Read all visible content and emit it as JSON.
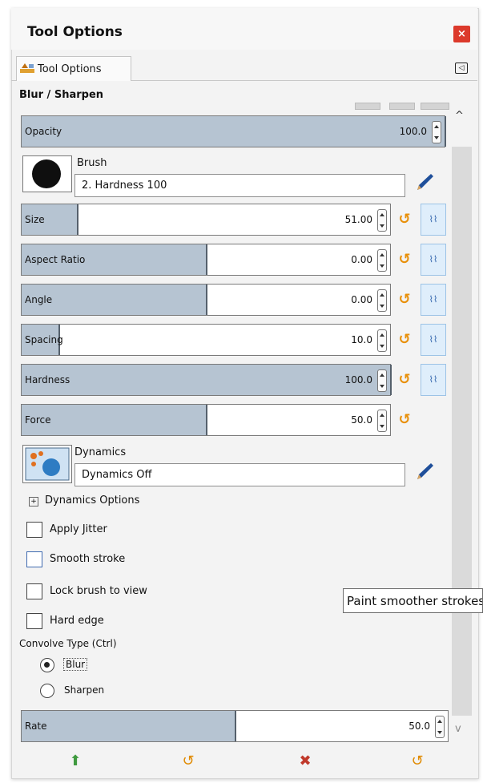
{
  "window": {
    "title": "Tool Options",
    "close_glyph": "×"
  },
  "tab": {
    "label": "Tool Options",
    "icon": "tool-options-icon"
  },
  "tab_menu_glyph": "◁",
  "section": "Blur / Sharpen",
  "opacity": {
    "label": "Opacity",
    "value": "100.0",
    "fill": 1.0
  },
  "brush": {
    "label": "Brush",
    "name": "2. Hardness 100"
  },
  "sliders": [
    {
      "label": "Size",
      "value": "51.00",
      "fill": 0.15
    },
    {
      "label": "Aspect Ratio",
      "value": "0.00",
      "fill": 0.5
    },
    {
      "label": "Angle",
      "value": "0.00",
      "fill": 0.5
    },
    {
      "label": "Spacing",
      "value": "10.0",
      "fill": 0.1
    },
    {
      "label": "Hardness",
      "value": "100.0",
      "fill": 1.0
    },
    {
      "label": "Force",
      "value": "50.0",
      "fill": 0.5
    }
  ],
  "chain_glyph": "⌇⌇",
  "reset_glyph": "↺",
  "dynamics": {
    "label": "Dynamics",
    "name": "Dynamics Off",
    "expander_label": "Dynamics Options"
  },
  "checkboxes": [
    {
      "label": "Apply Jitter",
      "checked": false
    },
    {
      "label": "Smooth stroke",
      "checked": false
    },
    {
      "label": "Lock brush to view",
      "checked": false
    },
    {
      "label": "Hard edge",
      "checked": false
    }
  ],
  "tooltip": "Paint smoother strokes",
  "convolve": {
    "label": "Convolve Type  (Ctrl)",
    "options": [
      {
        "label": "Blur",
        "selected": true
      },
      {
        "label": "Sharpen",
        "selected": false
      }
    ]
  },
  "rate": {
    "label": "Rate",
    "value": "50.0",
    "fill": 0.5
  },
  "bottom_buttons": [
    {
      "name": "save-options-button",
      "glyph": "⬆",
      "color": "#3f9a3f"
    },
    {
      "name": "restore-options-button",
      "glyph": "↺",
      "color": "#e08a00"
    },
    {
      "name": "delete-options-button",
      "glyph": "✖",
      "color": "#c0392b"
    },
    {
      "name": "reset-options-button",
      "glyph": "↺",
      "color": "#e08a00"
    }
  ],
  "colors": {
    "slider_fill": "#b6c4d2",
    "reset": "#e8900a",
    "chain_bg": "#dfeefb",
    "close": "#dc3a2c"
  }
}
